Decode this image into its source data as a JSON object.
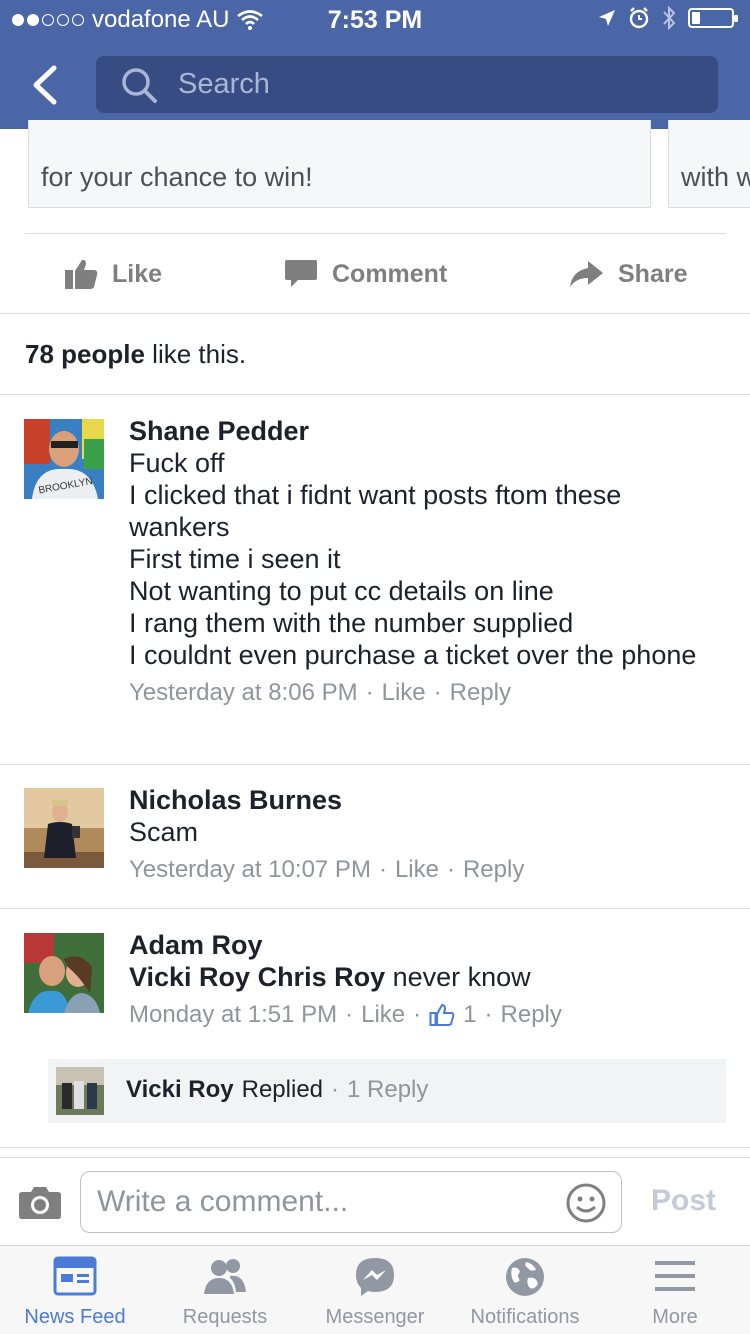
{
  "status_bar": {
    "carrier": "vodafone AU",
    "time": "7:53 PM",
    "signal_bars_filled": 2,
    "signal_bars_total": 5,
    "battery_level": 0.2
  },
  "nav": {
    "search_placeholder": "Search"
  },
  "cards": [
    {
      "text": "for your chance to win!"
    },
    {
      "text": "with w"
    }
  ],
  "actions": {
    "like": "Like",
    "comment": "Comment",
    "share": "Share"
  },
  "likes": {
    "count_text": "78 people",
    "suffix": " like this."
  },
  "comments": [
    {
      "name": "Shane Pedder",
      "text": "Fuck off\nI clicked that i fidnt want posts ftom these wankers\nFirst time  i seen it\nNot wanting to put cc details on line\nI rang them with the number supplied\nI couldnt even purchase a ticket over the phone",
      "time": "Yesterday at 8:06 PM",
      "like_label": "Like",
      "reply_label": "Reply"
    },
    {
      "name": "Nicholas Burnes",
      "text": "Scam",
      "time": "Yesterday at 10:07 PM",
      "like_label": "Like",
      "reply_label": "Reply"
    },
    {
      "name": "Adam Roy",
      "tagged": "Vicki Roy Chris Roy",
      "text": " never know",
      "time": "Monday at 1:51 PM",
      "like_label": "Like",
      "like_count": "1",
      "reply_label": "Reply"
    }
  ],
  "reply_preview": {
    "name": "Vicki Roy",
    "action": "Replied",
    "count": "1 Reply"
  },
  "composer": {
    "placeholder": "Write a comment...",
    "post_label": "Post"
  },
  "tabs": [
    {
      "label": "News Feed",
      "icon": "news-feed-icon",
      "active": true
    },
    {
      "label": "Requests",
      "icon": "friend-requests-icon",
      "active": false
    },
    {
      "label": "Messenger",
      "icon": "messenger-icon",
      "active": false
    },
    {
      "label": "Notifications",
      "icon": "globe-icon",
      "active": false
    },
    {
      "label": "More",
      "icon": "hamburger-icon",
      "active": false
    }
  ],
  "colors": {
    "header": "#4a66a7",
    "search_bg": "#364c83",
    "accent": "#4b7bd6",
    "muted": "#90949c"
  }
}
